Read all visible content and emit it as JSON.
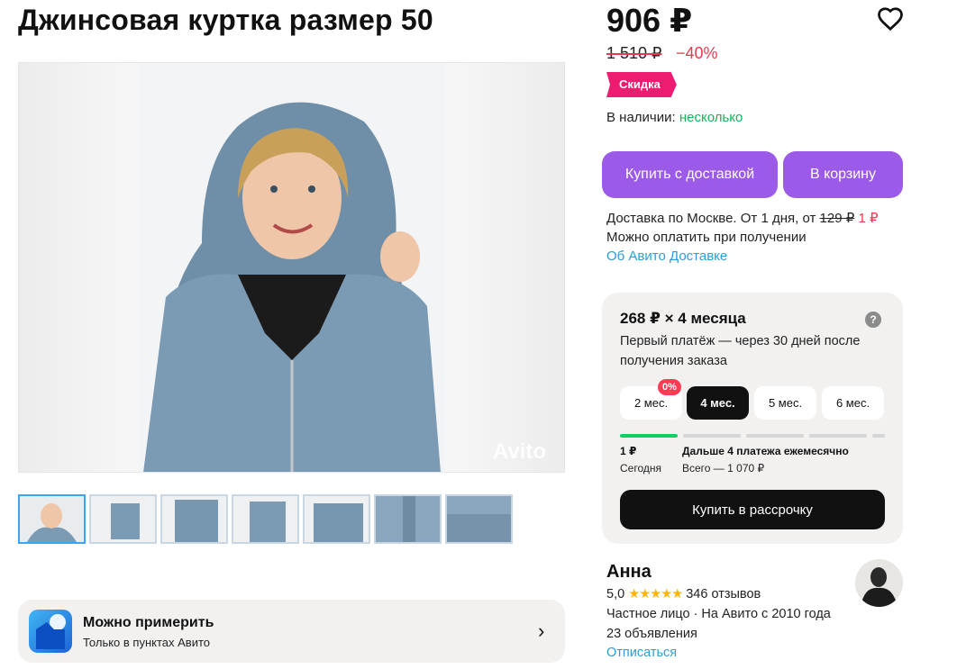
{
  "title": "Джинсовая куртка размер 50",
  "gallery": {
    "watermark": "Avito"
  },
  "try_on": {
    "title": "Можно примерить",
    "subtitle": "Только в пунктах Авито",
    "chevron": "›"
  },
  "price": {
    "current": "906 ₽",
    "old": "1 510 ₽",
    "discount": "−40%",
    "badge": "Скидка"
  },
  "stock": {
    "label": "В наличии: ",
    "value": "несколько"
  },
  "buttons": {
    "buy_delivery": "Купить с доставкой",
    "to_cart": "В корзину"
  },
  "delivery": {
    "prefix": "Доставка по Москве. От 1 дня, от ",
    "old_price": "129 ₽",
    "new_price": " 1 ₽",
    "payment": "Можно оплатить при получении",
    "link": "Об Авито Доставке"
  },
  "installment": {
    "title": "268 ₽ × 4 месяца",
    "help": "?",
    "description": "Первый платёж — через 30 дней после получения заказа",
    "terms": [
      "2 мес.",
      "4 мес.",
      "5 мес.",
      "6 мес."
    ],
    "selected_term": 1,
    "zero_badge": "0%",
    "first_amount": "1 ₽",
    "first_when": "Сегодня",
    "rest_label": "Дальше 4 платежа ежемесячно",
    "total": "Всего — 1 070 ₽",
    "button": "Купить в рассрочку"
  },
  "seller": {
    "name": "Анна",
    "rating": "5,0",
    "stars": "★★★★★",
    "reviews": "346 отзывов",
    "type": "Частное лицо · На Авито с 2010 года",
    "ads": "23 объявления",
    "unsubscribe": "Отписаться"
  },
  "colors": {
    "purple": "#9c5ae8",
    "pink_badge": "#ee1c71",
    "green": "#11b65b",
    "red": "#e8384d",
    "link": "#2a9fd6"
  }
}
